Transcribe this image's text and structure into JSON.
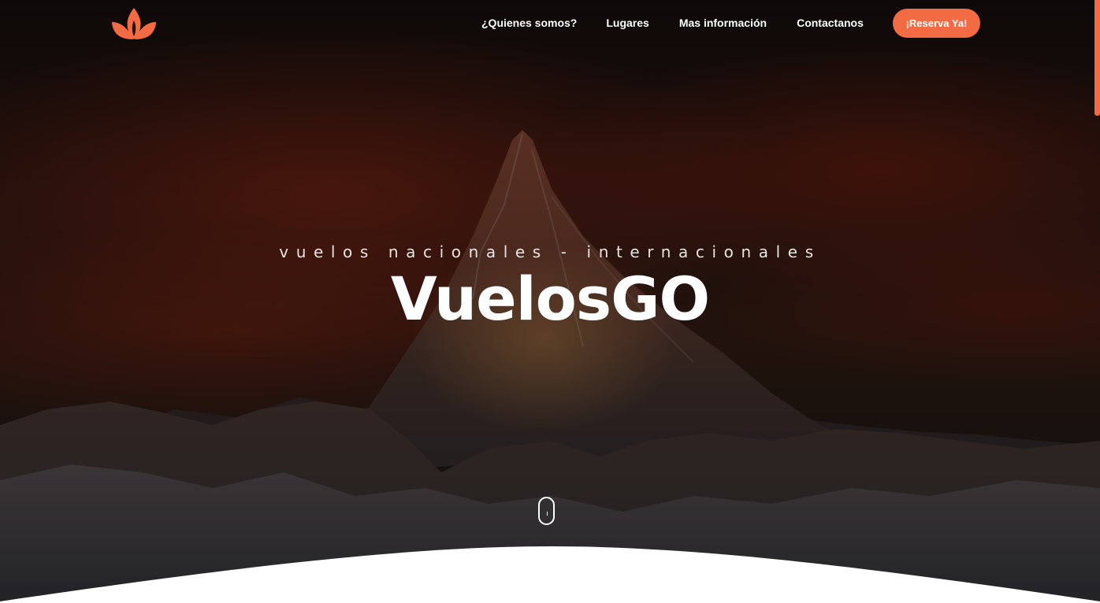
{
  "header": {
    "logo_icon": "lotus-flame-icon",
    "nav": [
      {
        "label": "¿Quienes somos?"
      },
      {
        "label": "Lugares"
      },
      {
        "label": "Mas información"
      },
      {
        "label": "Contactanos"
      }
    ],
    "cta_label": "¡Reserva Ya!"
  },
  "hero": {
    "subtitle": "vuelos nacionales - internacionales",
    "title": "VuelosGO",
    "scroll_icon": "mouse-scroll-icon"
  },
  "colors": {
    "accent": "#f26b43",
    "text": "#ffffff",
    "background_dark": "#1a0f0c",
    "section_bg": "#ffffff"
  }
}
